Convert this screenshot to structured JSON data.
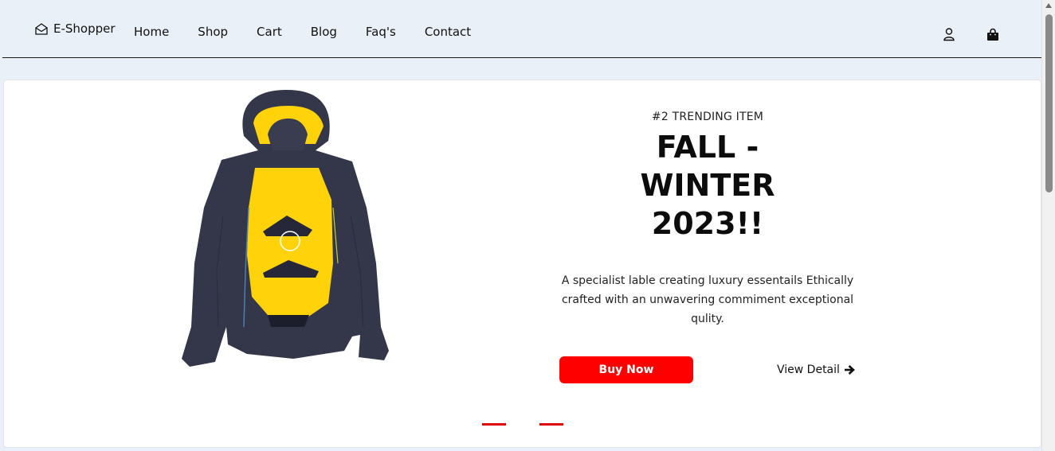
{
  "navbar": {
    "brand": "E-Shopper",
    "links": [
      "Home",
      "Shop",
      "Cart",
      "Blog",
      "Faq's",
      "Contact"
    ],
    "icons": {
      "user": "user-icon",
      "cart": "shopping-bag-icon",
      "brand": "envelope-open-icon"
    }
  },
  "hero": {
    "eyebrow": "#2 TRENDING ITEM",
    "headline": "FALL - WINTER 2023!!",
    "description": "A specialist lable creating luxury essentails Ethically crafted with an unwavering commiment exceptional qulity.",
    "buy_label": "Buy Now",
    "detail_label": "View Detail",
    "image": "winter-jacket-image",
    "slides": 2,
    "active_slide": 1
  },
  "colors": {
    "accent": "#ff0000",
    "page_bg": "#e9f0f7",
    "card_bg": "#ffffff",
    "jacket_body": "#34364a",
    "jacket_lining": "#ffd20a"
  }
}
